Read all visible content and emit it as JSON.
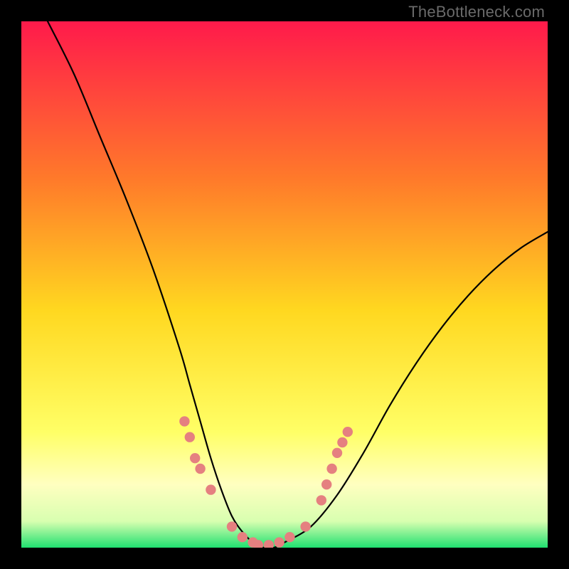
{
  "watermark": "TheBottleneck.com",
  "colors": {
    "frame": "#000000",
    "gradient_top": "#ff1a4b",
    "gradient_mid_upper": "#ff8a2a",
    "gradient_mid": "#ffd820",
    "gradient_mid_lower": "#ffff66",
    "gradient_pale": "#ffffb0",
    "gradient_bottom": "#20e070",
    "curve": "#000000",
    "marker": "#e58080"
  },
  "chart_data": {
    "type": "line",
    "title": "",
    "xlabel": "",
    "ylabel": "",
    "xlim": [
      0,
      100
    ],
    "ylim": [
      0,
      100
    ],
    "series": [
      {
        "name": "bottleneck-curve",
        "x": [
          5,
          10,
          15,
          20,
          25,
          30,
          32,
          34,
          36,
          38,
          40,
          42,
          44,
          46,
          48,
          50,
          55,
          60,
          65,
          70,
          75,
          80,
          85,
          90,
          95,
          100
        ],
        "y": [
          100,
          90,
          78,
          66,
          53,
          38,
          31,
          24,
          17,
          11,
          6,
          3,
          1,
          0,
          0,
          1,
          4,
          10,
          18,
          27,
          35,
          42,
          48,
          53,
          57,
          60
        ]
      }
    ],
    "markers": [
      {
        "x": 31,
        "y": 24
      },
      {
        "x": 32,
        "y": 21
      },
      {
        "x": 33,
        "y": 17
      },
      {
        "x": 34,
        "y": 15
      },
      {
        "x": 36,
        "y": 11
      },
      {
        "x": 40,
        "y": 4
      },
      {
        "x": 42,
        "y": 2
      },
      {
        "x": 44,
        "y": 1
      },
      {
        "x": 45,
        "y": 0.5
      },
      {
        "x": 47,
        "y": 0.5
      },
      {
        "x": 49,
        "y": 1
      },
      {
        "x": 51,
        "y": 2
      },
      {
        "x": 54,
        "y": 4
      },
      {
        "x": 57,
        "y": 9
      },
      {
        "x": 58,
        "y": 12
      },
      {
        "x": 59,
        "y": 15
      },
      {
        "x": 60,
        "y": 18
      },
      {
        "x": 61,
        "y": 20
      },
      {
        "x": 62,
        "y": 22
      }
    ],
    "gradient_stops": [
      {
        "offset": 0,
        "color": "#ff1a4b"
      },
      {
        "offset": 30,
        "color": "#ff7a2a"
      },
      {
        "offset": 55,
        "color": "#ffd820"
      },
      {
        "offset": 78,
        "color": "#ffff66"
      },
      {
        "offset": 88,
        "color": "#ffffc0"
      },
      {
        "offset": 95,
        "color": "#d8ffb0"
      },
      {
        "offset": 100,
        "color": "#20e070"
      }
    ]
  }
}
